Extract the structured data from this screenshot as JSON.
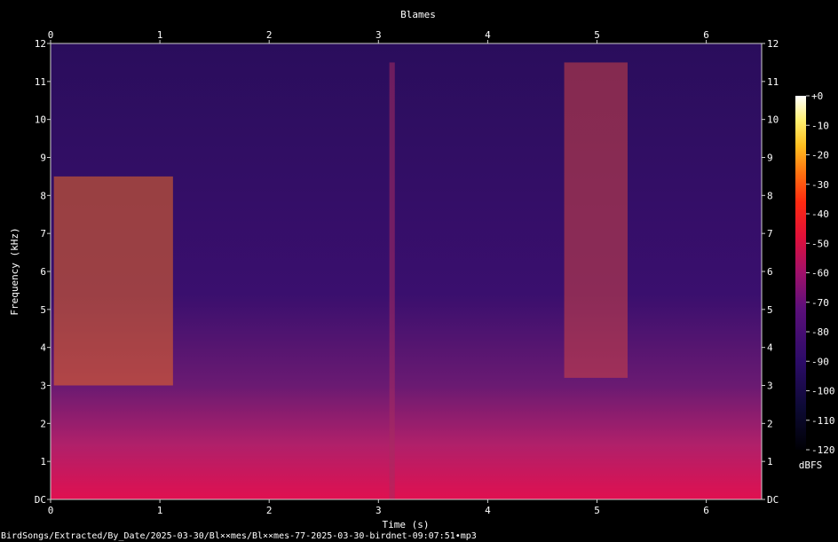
{
  "chart_data": {
    "type": "heatmap",
    "title": "Blames",
    "xlabel": "Time (s)",
    "ylabel": "Frequency (kHz)",
    "xlim": [
      0,
      6.5
    ],
    "ylim": [
      0,
      12
    ],
    "x_ticks": [
      "0",
      "1",
      "2",
      "3",
      "4",
      "5",
      "6"
    ],
    "y_ticks": [
      "DC",
      "1",
      "2",
      "3",
      "4",
      "5",
      "6",
      "7",
      "8",
      "9",
      "10",
      "11",
      "12"
    ],
    "colorbar": {
      "label": "dBFS",
      "ticks": [
        "+0",
        "-10",
        "-20",
        "-30",
        "-40",
        "-50",
        "-60",
        "-70",
        "-80",
        "-90",
        "-100",
        "-110",
        "-120"
      ],
      "range": [
        -120,
        0
      ],
      "colormap": [
        "#000004",
        "#1b0c41",
        "#4a0c6b",
        "#781c6d",
        "#a52c60",
        "#cf4446",
        "#ed6925",
        "#fb9b06",
        "#f7d13d",
        "#fcffa4",
        "#ffffff"
      ]
    },
    "grid": false,
    "events": [
      {
        "t_start": 0.03,
        "t_end": 1.12,
        "f_low": 3.0,
        "f_high": 8.5,
        "level_db": -45
      },
      {
        "t_start": 3.1,
        "t_end": 3.15,
        "f_low": 0.0,
        "f_high": 11.5,
        "level_db": -75
      },
      {
        "t_start": 4.7,
        "t_end": 5.28,
        "f_low": 3.2,
        "f_high": 11.5,
        "level_db": -55
      }
    ]
  },
  "footer": {
    "path": "BirdSongs/Extracted/By_Date/2025-03-30/Bl××mes/Bl××mes-77-2025-03-30-birdnet-09:07:51•mp3"
  }
}
